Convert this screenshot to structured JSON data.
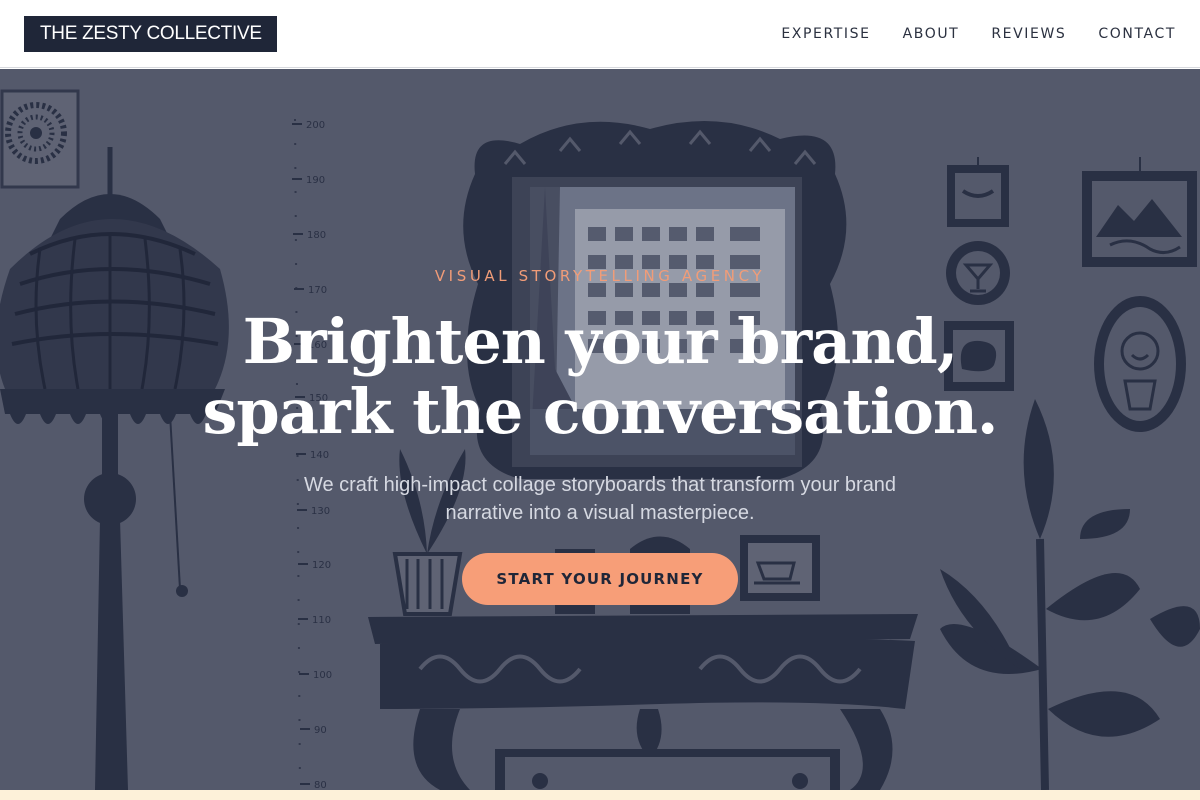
{
  "header": {
    "logo": "THE ZESTY COLLECTIVE",
    "nav": [
      "EXPERTISE",
      "ABOUT",
      "REVIEWS",
      "CONTACT"
    ]
  },
  "hero": {
    "eyebrow": "VISUAL STORYTELLING AGENCY",
    "headline_line1": "Brighten your brand,",
    "headline_line2": "spark the conversation.",
    "subtext_line1": "We craft high-impact collage storyboards that transform your brand",
    "subtext_line2": "narrative into a visual masterpiece.",
    "cta_label": "START YOUR JOURNEY",
    "ruler_ticks": [
      "200",
      "190",
      "180",
      "170",
      "160",
      "150",
      "140",
      "130",
      "120",
      "110",
      "100",
      "90",
      "80"
    ]
  },
  "colors": {
    "header_bg": "#ffffff",
    "logo_bg": "#1f2638",
    "hero_bg": "#5b5f70",
    "mural_ink": "#1e2438",
    "accent": "#f79e78",
    "eyebrow": "#f19c78",
    "bottom_strip": "#fdf1d9"
  }
}
